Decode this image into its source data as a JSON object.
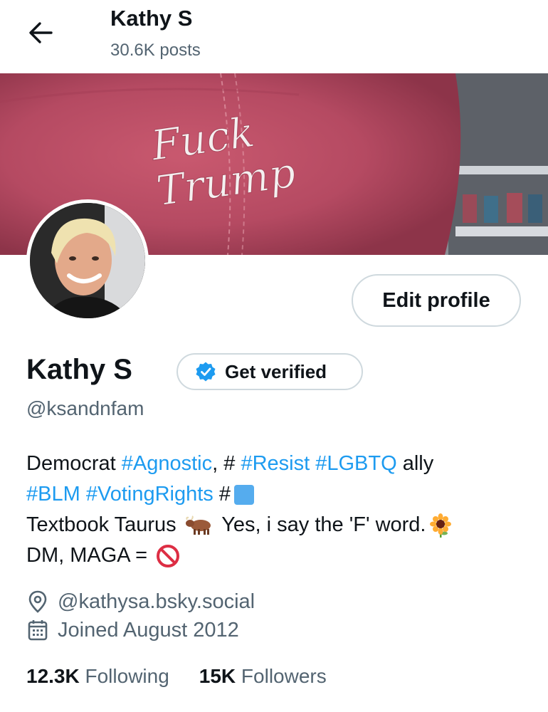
{
  "header": {
    "title": "Kathy S",
    "posts": "30.6K posts"
  },
  "banner": {
    "hat_text_line1": "Fuck",
    "hat_text_line2": "Trump"
  },
  "profile": {
    "edit_label": "Edit profile",
    "name": "Kathy S",
    "verify_label": "Get verified",
    "handle": "@ksandnfam"
  },
  "bio": {
    "l1_a": "Democrat ",
    "l1_tag1": "#Agnostic",
    "l1_b": ", # ",
    "l1_tag2": "#Resist",
    "l1_c": " ",
    "l1_tag3": "#LGBTQ",
    "l1_d": " ally",
    "l2_tag1": "#BLM",
    "l2_a": " ",
    "l2_tag2": "#VotingRights",
    "l2_b": " #",
    "l3_a": "Textbook Taurus ",
    "l3_b": " Yes, i say the 'F' word.",
    "l4_a": "DM, MAGA = "
  },
  "meta": {
    "location": "@kathysa.bsky.social",
    "joined": "Joined August 2012"
  },
  "stats": {
    "following_count": "12.3K",
    "following_label": " Following",
    "followers_count": "15K",
    "followers_label": " Followers"
  },
  "icons": {
    "back": "arrow-left-icon",
    "verified": "verified-badge-icon",
    "location": "location-pin-icon",
    "calendar": "calendar-icon",
    "blue-square": "blue-square-emoji",
    "ox": "ox-emoji",
    "sunflower": "sunflower-emoji",
    "prohibited": "prohibited-emoji"
  },
  "colors": {
    "link": "#1d9bf0",
    "muted": "#536471",
    "text": "#0f1419",
    "border": "#cfd9de"
  }
}
